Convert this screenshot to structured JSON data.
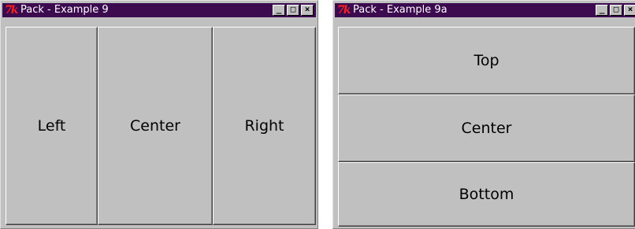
{
  "windows": [
    {
      "title": "Pack - Example 9",
      "logo": "7k",
      "controls": {
        "minimize": "_",
        "maximize": "□",
        "close": "×"
      },
      "buttons": [
        "Left",
        "Center",
        "Right"
      ]
    },
    {
      "title": "Pack - Example 9a",
      "logo": "7k",
      "controls": {
        "minimize": "_",
        "maximize": "□",
        "close": "×"
      },
      "buttons": [
        "Top",
        "Center",
        "Bottom"
      ]
    }
  ],
  "colors": {
    "titlebar": "#3b0a4f",
    "face": "#c0c0c0",
    "logo": "#ff2020"
  }
}
